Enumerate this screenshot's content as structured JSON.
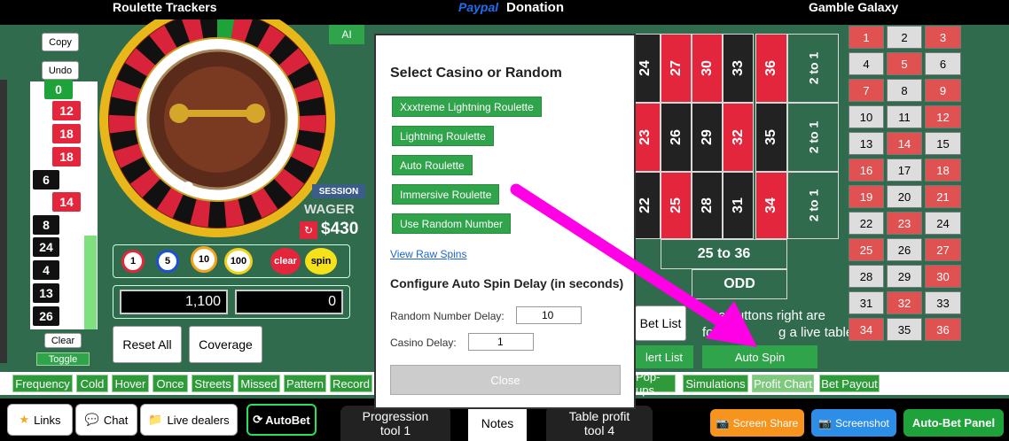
{
  "topbar": {
    "left": "Roulette Trackers",
    "paypal": "Paypal",
    "donation": "Donation",
    "right": "Gamble Galaxy"
  },
  "left": {
    "copy": "Copy",
    "undo": "Undo",
    "clear": "Clear",
    "toggle": "Toggle",
    "history": [
      {
        "n": "0",
        "c": "g"
      },
      {
        "n": "12",
        "c": "r"
      },
      {
        "n": "18",
        "c": "r"
      },
      {
        "n": "18",
        "c": "r"
      },
      {
        "n": "6",
        "c": "b"
      },
      {
        "n": "14",
        "c": "r"
      },
      {
        "n": "8",
        "c": "b"
      },
      {
        "n": "24",
        "c": "b"
      },
      {
        "n": "4",
        "c": "b"
      },
      {
        "n": "13",
        "c": "b"
      },
      {
        "n": "26",
        "c": "b"
      }
    ]
  },
  "wheel": {
    "session": "SESSION",
    "wager": "WAGER",
    "amount": "$430",
    "ai": "AI"
  },
  "chips": {
    "c1": "1",
    "c5": "5",
    "c10": "10",
    "c100": "100",
    "clear": "clear",
    "spin": "spin"
  },
  "balances": {
    "left": "1,100",
    "right": "0"
  },
  "actions": {
    "reset": "Reset All",
    "coverage": "Coverage"
  },
  "modal": {
    "title": "Select Casino or Random",
    "options": [
      "Xxxtreme Lightning Roulette",
      "Lightning Roulette",
      "Auto Roulette",
      "Immersive Roulette",
      "Use Random Number"
    ],
    "raw": "View Raw Spins",
    "delay_title": "Configure Auto Spin Delay (in seconds)",
    "random_label": "Random Number Delay:",
    "random_value": "10",
    "casino_label": "Casino Delay:",
    "casino_value": "1",
    "close": "Close"
  },
  "table": {
    "top": [
      "24",
      "27",
      "30",
      "33",
      "36"
    ],
    "mid": [
      "23",
      "26",
      "29",
      "32",
      "35"
    ],
    "bot": [
      "22",
      "25",
      "28",
      "31",
      "34"
    ],
    "two_to_one": "2 to 1",
    "dozen": "25 to 36",
    "odd": "ODD",
    "bet_list": "Bet List",
    "alert_list": "lert List",
    "auto_spin": "Auto Spin",
    "hint_a": "e buttons right are",
    "hint_b": "for",
    "hint_c": "g a live table."
  },
  "grid": [
    [
      "1",
      "2",
      "3"
    ],
    [
      "4",
      "5",
      "6"
    ],
    [
      "7",
      "8",
      "9"
    ],
    [
      "10",
      "11",
      "12"
    ],
    [
      "13",
      "14",
      "15"
    ],
    [
      "16",
      "17",
      "18"
    ],
    [
      "19",
      "20",
      "21"
    ],
    [
      "22",
      "23",
      "24"
    ],
    [
      "25",
      "26",
      "27"
    ],
    [
      "28",
      "29",
      "30"
    ],
    [
      "31",
      "32",
      "33"
    ],
    [
      "34",
      "35",
      "36"
    ]
  ],
  "tabs_left": [
    "Frequency",
    "Cold",
    "Hover",
    "Once",
    "Streets",
    "Missed",
    "Pattern",
    "Record"
  ],
  "tabs_right": [
    "Pop-ups",
    "Simulations",
    "Profit Chart",
    "Bet Payout"
  ],
  "bottom": {
    "links": "Links",
    "chat": "Chat",
    "live": "Live dealers",
    "autobet": "AutoBet",
    "prog_a": "Progression",
    "prog_b": "tool 1",
    "notes": "Notes",
    "tp_a": "Table profit",
    "tp_b": "tool 4",
    "screen": "Screen Share",
    "screenshot": "Screenshot",
    "panel": "Auto-Bet Panel"
  },
  "colors": {
    "felt": "#2f6b4c",
    "red": "#e3263b",
    "green": "#2fa44a",
    "magenta": "#ff00e6",
    "orange": "#f7941d",
    "blue": "#2d8ee8"
  }
}
